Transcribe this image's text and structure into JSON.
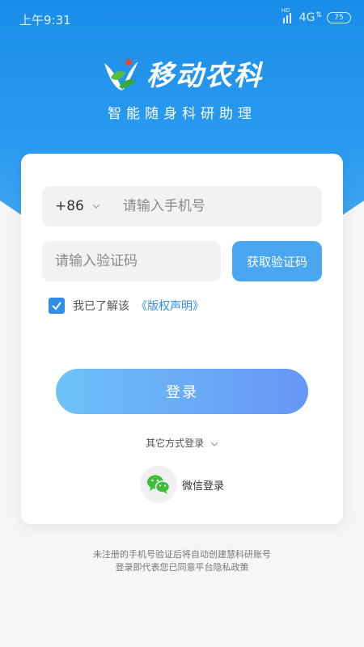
{
  "status_bar": {
    "time": "上午9:31",
    "signal_label": "HD",
    "network": "4G",
    "battery": "75"
  },
  "brand": {
    "app_name": "移动农科",
    "slogan": "智能随身科研助理"
  },
  "form": {
    "country_code": "+86",
    "phone_placeholder": "请输入手机号",
    "code_placeholder": "请输入验证码",
    "get_code_label": "获取验证码",
    "agree_text": "我已了解该",
    "agree_link": "《版权声明》",
    "login_label": "登录",
    "other_login_label": "其它方式登录",
    "wechat_label": "微信登录"
  },
  "footer": {
    "line1": "未注册的手机号验证后将自动创建慧科研账号",
    "line2": "登录即代表您已同意平台隐私政策"
  },
  "colors": {
    "brand_blue": "#1a8de9",
    "button_blue": "#4aa6f1",
    "login_gradient_start": "#6ec2f8",
    "login_gradient_end": "#6796f6"
  }
}
